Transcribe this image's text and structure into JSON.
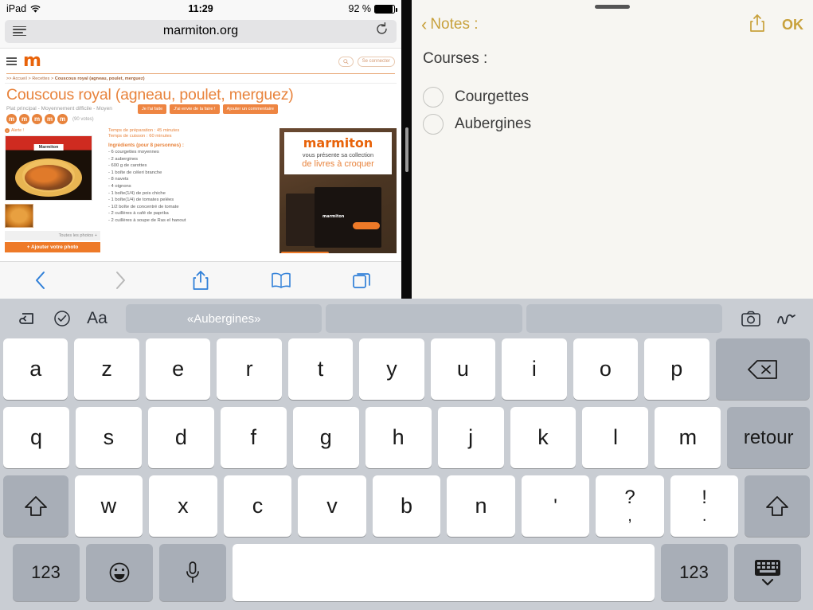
{
  "status_bar": {
    "device": "iPad",
    "wifi_icon": "wifi-icon",
    "time": "11:29",
    "battery_pct": "92 %",
    "battery_icon": "battery-icon"
  },
  "safari": {
    "menu_icon": "reader-menu-icon",
    "url": "marmiton.org",
    "reload_icon": "reload-icon",
    "toolbar": {
      "back_icon": "back-chevron-icon",
      "forward_icon": "forward-chevron-icon",
      "share_icon": "share-icon",
      "bookmarks_icon": "book-icon",
      "tabs_icon": "tabs-icon"
    }
  },
  "webpage": {
    "site_logo": "m",
    "menu_icon": "site-hamburger-icon",
    "search_icon": "search-icon",
    "login_label": "Se connecter",
    "breadcrumb_prefix": ">> Accueil > Recettes >",
    "breadcrumb_current": "Couscous royal (agneau, poulet, merguez)",
    "title": "Couscous royal (agneau, poulet, merguez)",
    "subtitle": "Plat principal - Moyennement difficile - Moyen",
    "rating_icon": "m",
    "rating_count": 5,
    "votes": "(90 votes)",
    "actions": [
      "Je l'ai faite",
      "J'ai envie de la faire !",
      "Ajouter un commentaire"
    ],
    "alert_label": "Alerte !",
    "photo_label": "Marmiton",
    "all_photos": "Toutes les photos +",
    "add_photo": "+ Ajouter votre photo",
    "prep_time": "Temps de préparation : 45 minutes",
    "cook_time": "Temps de cuisson : 60 minutes",
    "ingredients_header": "Ingrédients (pour 8 personnes) :",
    "ingredients": [
      "- 6 courgettes moyennes",
      "- 2 aubergines",
      "- 600 g de carottes",
      "- 1 boîte de céleri branche",
      "- 8 navets",
      "- 4 oignons",
      "- 1 boîte(1/4) de pois chiche",
      "- 1 boîte(1/4) de tomates pelées",
      "- 1/2 boîte de concentré de tomate",
      "- 2 cuillères à café de paprika",
      "- 2 cuillères à soupe de Ras el hanout"
    ],
    "ad": {
      "logo": "marmiton",
      "line1": "vous présente sa collection",
      "line2": "de livres à croquer",
      "box_label": "marmiton"
    }
  },
  "notes": {
    "grab_handle": "drag-handle",
    "back_label": "Notes :",
    "back_icon": "back-chevron-icon",
    "share_icon": "share-icon",
    "ok_label": "OK",
    "heading": "Courses :",
    "items": [
      {
        "label": "Courgettes",
        "checked": false
      },
      {
        "label": "Aubergines",
        "checked": false
      }
    ]
  },
  "keyboard": {
    "left_icons": [
      "undo-icon",
      "checklist-icon",
      "format-aa-icon"
    ],
    "right_icons": [
      "camera-icon",
      "markup-pen-icon"
    ],
    "suggestions": [
      "«Aubergines»",
      "",
      ""
    ],
    "row1": [
      "a",
      "z",
      "e",
      "r",
      "t",
      "y",
      "u",
      "i",
      "o",
      "p"
    ],
    "backspace_icon": "backspace-icon",
    "row2": [
      "q",
      "s",
      "d",
      "f",
      "g",
      "h",
      "j",
      "k",
      "l",
      "m"
    ],
    "return_label": "retour",
    "shift_left_icon": "shift-icon",
    "shift_right_icon": "shift-icon",
    "row3": [
      "w",
      "x",
      "c",
      "v",
      "b",
      "n"
    ],
    "row3_punct": [
      {
        "top": "'",
        "bottom": ""
      },
      {
        "top": "?",
        "bottom": ","
      },
      {
        "top": "!",
        "bottom": "."
      }
    ],
    "num_left": "123",
    "emoji_icon": "emoji-icon",
    "mic_icon": "microphone-icon",
    "space_label": "",
    "num_right": "123",
    "dismiss_icon": "hide-keyboard-icon"
  }
}
